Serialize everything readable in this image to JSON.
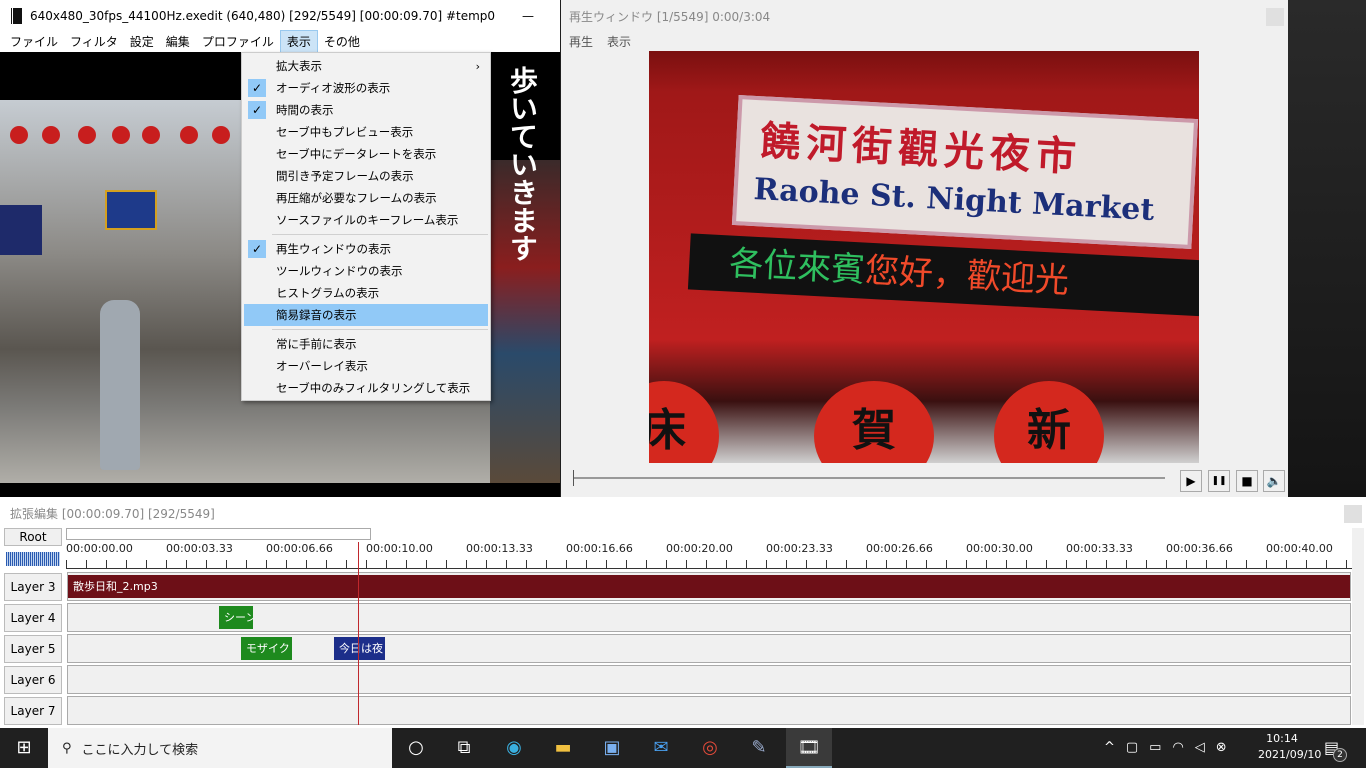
{
  "main_window": {
    "title": "640x480_30fps_44100Hz.exedit (640,480)  [292/5549] [00:00:09.70]  #temp0",
    "minimize": "—",
    "menu": [
      "ファイル",
      "フィルタ",
      "設定",
      "編集",
      "プロファイル",
      "表示",
      "その他"
    ],
    "video_caption": "歩いていきます"
  },
  "view_menu": {
    "items": [
      {
        "label": "拡大表示",
        "checked": false,
        "submenu": true
      },
      {
        "label": "オーディオ波形の表示",
        "checked": true
      },
      {
        "label": "時間の表示",
        "checked": true
      },
      {
        "label": "セーブ中もプレビュー表示",
        "checked": false
      },
      {
        "label": "セーブ中にデータレートを表示",
        "checked": false
      },
      {
        "label": "間引き予定フレームの表示",
        "checked": false
      },
      {
        "label": "再圧縮が必要なフレームの表示",
        "checked": false
      },
      {
        "label": "ソースファイルのキーフレーム表示",
        "checked": false
      },
      {
        "label": "再生ウィンドウの表示",
        "checked": true
      },
      {
        "label": "ツールウィンドウの表示",
        "checked": false
      },
      {
        "label": "ヒストグラムの表示",
        "checked": false
      },
      {
        "label": "簡易録音の表示",
        "checked": false,
        "highlighted": true
      },
      {
        "label": "常に手前に表示",
        "checked": false
      },
      {
        "label": "オーバーレイ表示",
        "checked": false
      },
      {
        "label": "セーブ中のみフィルタリングして表示",
        "checked": false
      }
    ],
    "check": "✓",
    "arrow": "›"
  },
  "play_window": {
    "title": "再生ウィンドウ  [1/5549]  0:00/3:04",
    "menu": [
      "再生",
      "表示"
    ],
    "sign_cn": "饒河街觀光夜市",
    "sign_en": "Raohe St. Night Market",
    "led_green": "各位來賓",
    "led_red": "您好，歡迎光",
    "lanterns": [
      "床",
      "賀",
      "新"
    ],
    "controls": {
      "play": "▶",
      "pause": "❚❚",
      "stop": "■",
      "volume": "🔈"
    }
  },
  "timeline": {
    "title": "拡張編集 [00:00:09.70] [292/5549]",
    "root": "Root",
    "ticks": [
      "00:00:00.00",
      "00:00:03.33",
      "00:00:06.66",
      "00:00:10.00",
      "00:00:13.33",
      "00:00:16.66",
      "00:00:20.00",
      "00:00:23.33",
      "00:00:26.66",
      "00:00:30.00",
      "00:00:33.33",
      "00:00:36.66",
      "00:00:40.00"
    ],
    "layers": [
      "Layer 3",
      "Layer 4",
      "Layer 5",
      "Layer 6",
      "Layer 7"
    ],
    "clips": {
      "audio": "散歩日和_2.mp3",
      "scene": "シーン",
      "mosaic": "モザイク",
      "text": "今日は夜"
    },
    "colors": {
      "audio": "#6d0f17",
      "green": "#1e8a1e",
      "blue": "#1c2e8a",
      "cursor": "#c0282d"
    }
  },
  "taskbar": {
    "search_placeholder": "ここに入力して検索",
    "time": "10:14",
    "date": "2021/09/10",
    "notifications": "2"
  }
}
